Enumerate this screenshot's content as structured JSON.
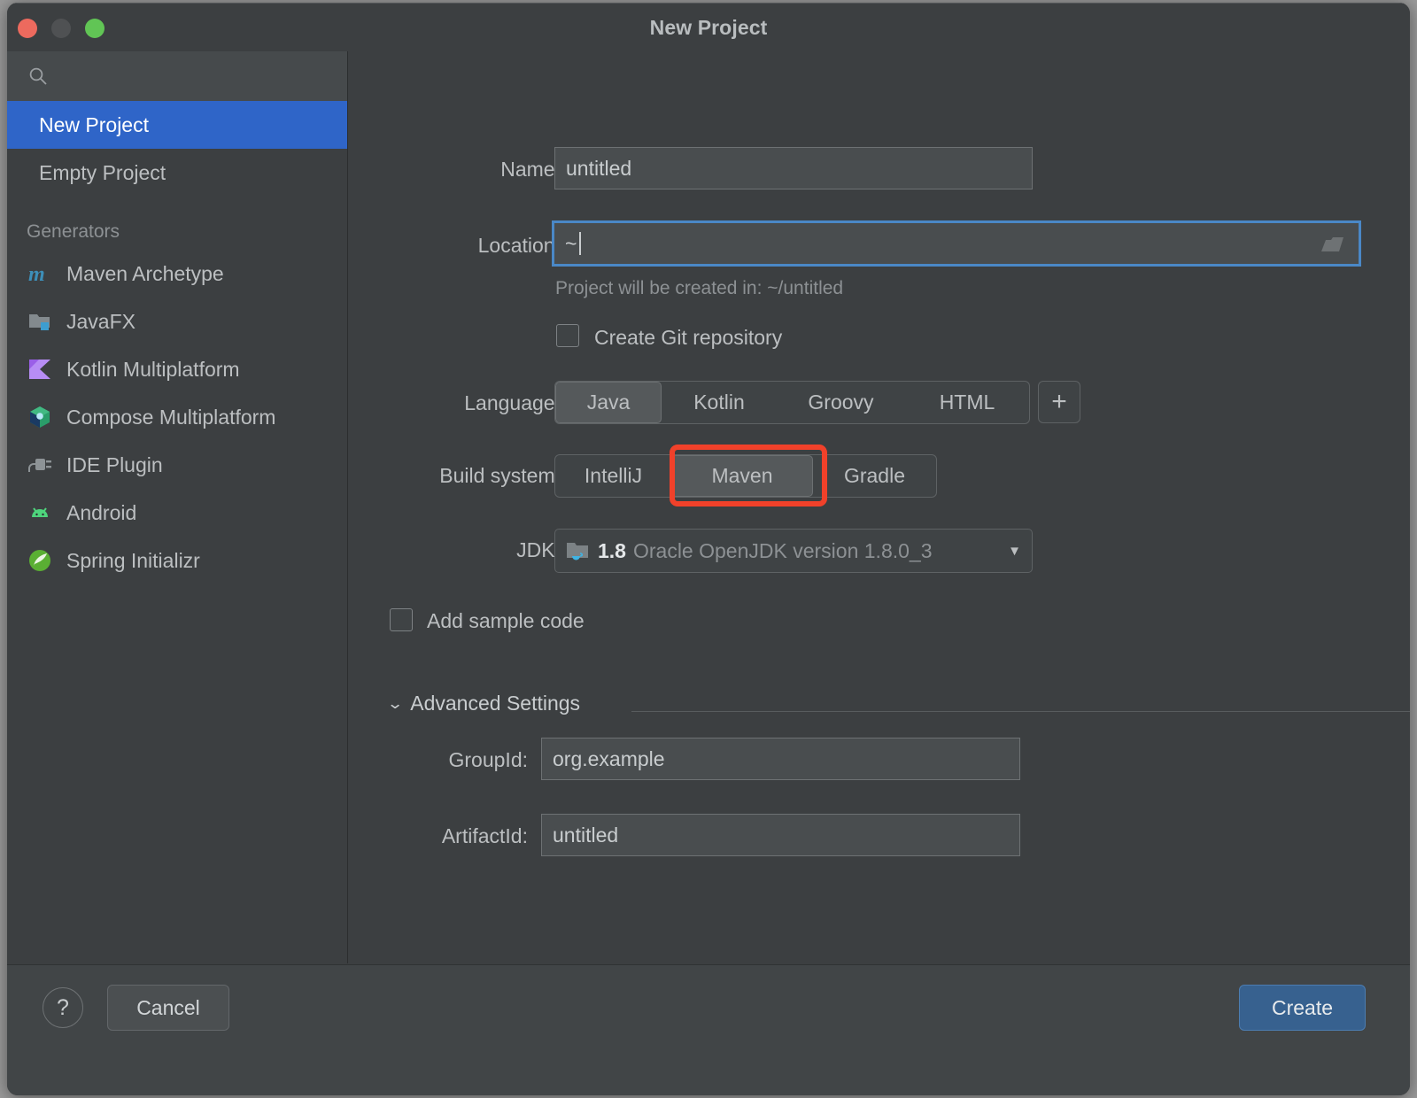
{
  "window": {
    "title": "New Project",
    "traffic_lights": [
      {
        "name": "close",
        "color": "#ed6a5e"
      },
      {
        "name": "minimize",
        "color": "#4f5153"
      },
      {
        "name": "maximize",
        "color": "#61c555"
      }
    ]
  },
  "sidebar": {
    "search_placeholder": "",
    "items": [
      {
        "label": "New Project",
        "selected": true
      },
      {
        "label": "Empty Project",
        "selected": false
      }
    ],
    "section_label": "Generators",
    "generators": [
      {
        "label": "Maven Archetype",
        "icon": "maven-archetype-icon"
      },
      {
        "label": "JavaFX",
        "icon": "javafx-icon"
      },
      {
        "label": "Kotlin Multiplatform",
        "icon": "kotlin-multiplatform-icon"
      },
      {
        "label": "Compose Multiplatform",
        "icon": "compose-multiplatform-icon"
      },
      {
        "label": "IDE Plugin",
        "icon": "ide-plugin-icon"
      },
      {
        "label": "Android",
        "icon": "android-icon"
      },
      {
        "label": "Spring Initializr",
        "icon": "spring-initializr-icon"
      }
    ]
  },
  "form": {
    "name": {
      "label": "Name:",
      "value": "untitled"
    },
    "location": {
      "label": "Location:",
      "value": "~",
      "browse_icon": "folder-icon"
    },
    "location_hint": "Project will be created in: ~/untitled",
    "git": {
      "label": "Create Git repository",
      "checked": false
    },
    "language": {
      "label": "Language:",
      "options": [
        "Java",
        "Kotlin",
        "Groovy",
        "HTML"
      ],
      "selected": "Java",
      "add_label": "+"
    },
    "build_system": {
      "label": "Build system:",
      "options": [
        "IntelliJ",
        "Maven",
        "Gradle"
      ],
      "selected": "Maven",
      "highlighted": "Maven"
    },
    "jdk": {
      "label": "JDK:",
      "version": "1.8",
      "description": "Oracle OpenJDK version 1.8.0_3",
      "arrow": "▼"
    },
    "sample_code": {
      "label": "Add sample code",
      "checked": false
    },
    "advanced": {
      "header": "Advanced Settings",
      "chevron": "⌄",
      "group_id": {
        "label": "GroupId:",
        "value": "org.example"
      },
      "artifact_id": {
        "label": "ArtifactId:",
        "value": "untitled"
      }
    }
  },
  "footer": {
    "help_label": "?",
    "cancel_label": "Cancel",
    "create_label": "Create"
  },
  "colors": {
    "accent_blue": "#2f65c8",
    "create_blue": "#37618f",
    "focus_border": "#4a88c7",
    "highlight_red": "#f1412a",
    "window_bg": "#3c3f41"
  }
}
